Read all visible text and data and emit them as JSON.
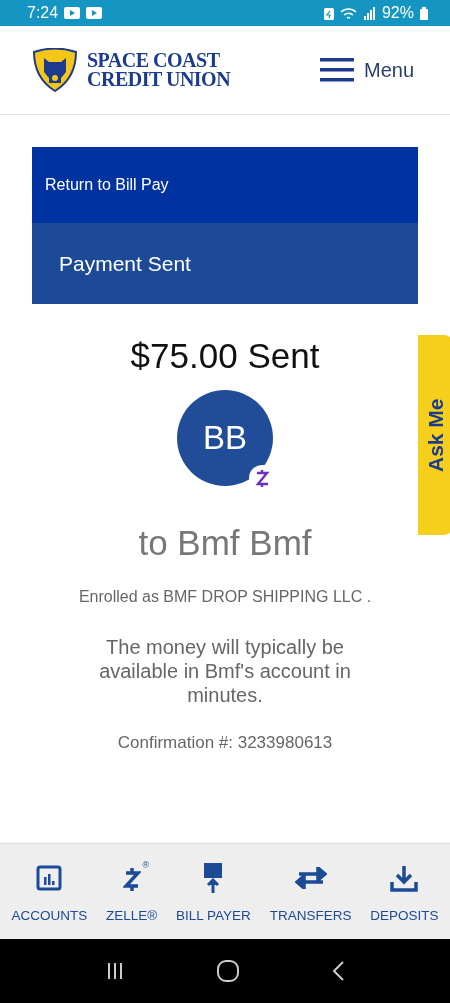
{
  "status_bar": {
    "time": "7:24",
    "battery": "92%"
  },
  "header": {
    "logo_line1": "SPACE COAST",
    "logo_line2": "CREDIT UNION",
    "menu_label": "Menu"
  },
  "banner": {
    "back_link": "Return to Bill Pay",
    "title": "Payment Sent"
  },
  "payment": {
    "amount": "$75.00 Sent",
    "initials": "BB",
    "recipient": "to Bmf Bmf",
    "enrolled": "Enrolled as BMF DROP SHIPPING LLC .",
    "note": "The money will typically be available in Bmf's account in minutes.",
    "confirmation": "Confirmation #: 3233980613"
  },
  "ask_me": {
    "label": "Ask Me"
  },
  "bottom_nav": [
    {
      "kind": "accounts",
      "label": "ACCOUNTS"
    },
    {
      "kind": "zelle",
      "label": "ZELLE®",
      "mark": "®"
    },
    {
      "kind": "billpay",
      "label": "BILL PAYER"
    },
    {
      "kind": "transfers",
      "label": "TRANSFERS"
    },
    {
      "kind": "deposits",
      "label": "DEPOSITS"
    }
  ]
}
